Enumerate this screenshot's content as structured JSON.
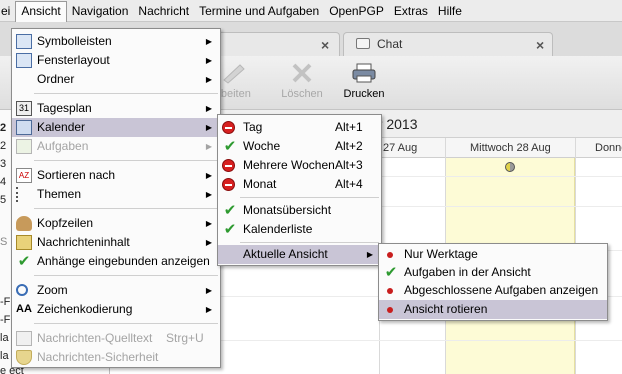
{
  "menubar": {
    "items": [
      {
        "label": "ei",
        "name": "menu-ei"
      },
      {
        "label": "Ansicht",
        "name": "menu-ansicht"
      },
      {
        "label": "Navigation",
        "name": "menu-navigation"
      },
      {
        "label": "Nachricht",
        "name": "menu-nachricht"
      },
      {
        "label": "Termine und Aufgaben",
        "name": "menu-termine"
      },
      {
        "label": "OpenPGP",
        "name": "menu-openpgp"
      },
      {
        "label": "Extras",
        "name": "menu-extras"
      },
      {
        "label": "Hilfe",
        "name": "menu-hilfe"
      }
    ]
  },
  "tabs": {
    "chat_label": "Chat"
  },
  "toolbar": {
    "edit_label": "rbeiten",
    "delete_label": "Löschen",
    "print_label": "Drucken"
  },
  "calendar": {
    "title_fragment": "er 2013",
    "days": [
      "27 Aug",
      "Mittwoch 28 Aug",
      "Donne"
    ]
  },
  "left_pane": {
    "texts": [
      "2",
      "2",
      "3",
      "4",
      "5",
      "S",
      "-F",
      "-F",
      "la",
      "la",
      "e ect"
    ]
  },
  "ansicht_menu": {
    "items": [
      {
        "label": "Symbolleisten",
        "icon": "toolbar-icon"
      },
      {
        "label": "Fensterlayout",
        "icon": "window-layout-icon"
      },
      {
        "label": "Ordner",
        "icon": "folder-icon"
      },
      {
        "label": "Tagesplan",
        "icon": "day-planner-icon"
      },
      {
        "label": "Kalender",
        "icon": "calendar-icon"
      },
      {
        "label": "Aufgaben",
        "icon": "tasks-icon"
      },
      {
        "label": "Sortieren nach",
        "icon": "sort-icon"
      },
      {
        "label": "Themen",
        "icon": "threads-icon"
      },
      {
        "label": "Kopfzeilen",
        "icon": "headers-icon"
      },
      {
        "label": "Nachrichteninhalt",
        "icon": "message-body-icon"
      },
      {
        "label": "Anhänge eingebunden anzeigen",
        "icon": "check-icon"
      },
      {
        "label": "Zoom",
        "icon": "zoom-icon"
      },
      {
        "label": "Zeichenkodierung",
        "icon": "character-encoding-icon"
      },
      {
        "label": "Nachrichten-Quelltext",
        "shortcut": "Strg+U",
        "icon": "source-icon"
      },
      {
        "label": "Nachrichten-Sicherheit",
        "icon": "security-icon"
      }
    ]
  },
  "kalender_menu": {
    "items": [
      {
        "label": "Tag",
        "shortcut": "Alt+1"
      },
      {
        "label": "Woche",
        "shortcut": "Alt+2"
      },
      {
        "label": "Mehrere Wochen",
        "shortcut": "Alt+3"
      },
      {
        "label": "Monat",
        "shortcut": "Alt+4"
      },
      {
        "label": "Monatsübersicht"
      },
      {
        "label": "Kalenderliste"
      },
      {
        "label": "Aktuelle Ansicht"
      }
    ]
  },
  "aktuelle_menu": {
    "items": [
      {
        "label": "Nur Werktage"
      },
      {
        "label": "Aufgaben in der Ansicht"
      },
      {
        "label": "Abgeschlossene Aufgaben anzeigen"
      },
      {
        "label": "Ansicht rotieren"
      }
    ]
  },
  "colors": {
    "highlight": "#c9c5d6",
    "today": "#fdfbd6",
    "check": "#2e9a30",
    "stop": "#d72020"
  }
}
